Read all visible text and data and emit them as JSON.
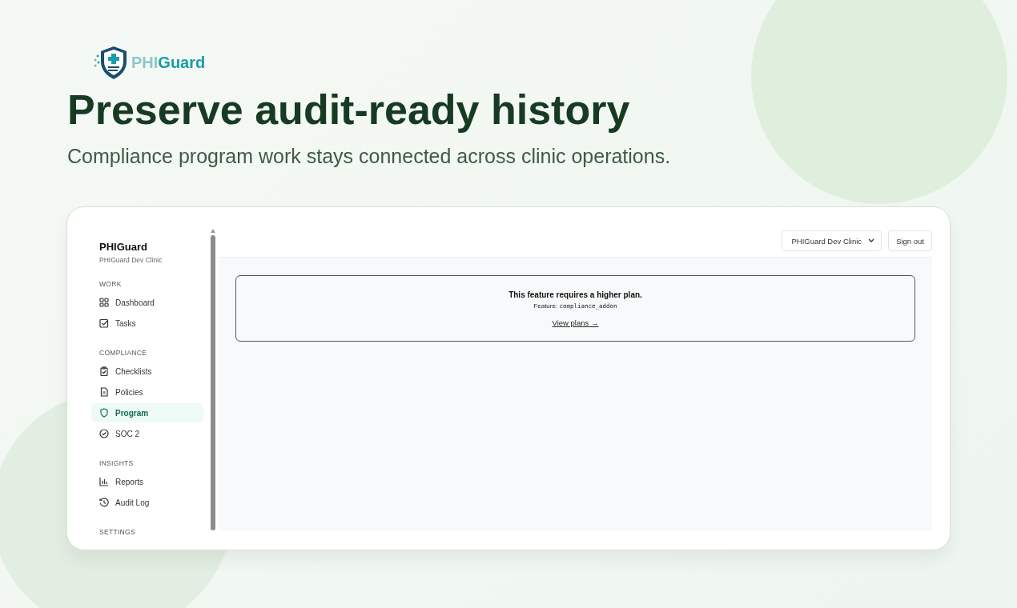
{
  "logo": {
    "part_1": "PHI",
    "part_2": "Guard"
  },
  "headline": "Preserve audit-ready history",
  "subheadline": "Compliance program work stays connected across clinic operations.",
  "app": {
    "sidebar": {
      "title": "PHIGuard",
      "subtitle": "PHIGuard Dev Clinic",
      "sections": [
        {
          "label": "WORK",
          "items": [
            {
              "label": "Dashboard",
              "kind": "grid",
              "selected": false
            },
            {
              "label": "Tasks",
              "kind": "check-square",
              "selected": false
            }
          ]
        },
        {
          "label": "COMPLIANCE",
          "items": [
            {
              "label": "Checklists",
              "kind": "clipboard",
              "selected": false
            },
            {
              "label": "Policies",
              "kind": "document",
              "selected": false
            },
            {
              "label": "Program",
              "kind": "shield",
              "selected": true
            },
            {
              "label": "SOC 2",
              "kind": "check-circle",
              "selected": false
            }
          ]
        },
        {
          "label": "INSIGHTS",
          "items": [
            {
              "label": "Reports",
              "kind": "bars",
              "selected": false
            },
            {
              "label": "Audit Log",
              "kind": "history",
              "selected": false
            }
          ]
        },
        {
          "label": "SETTINGS"
        }
      ]
    },
    "header": {
      "clinic_select": "PHIGuard Dev Clinic",
      "sign_out": "Sign out"
    },
    "notice": {
      "title": "This feature requires a higher plan.",
      "feature_label": "Feature:",
      "feature_code": "compliance_addon",
      "link": "View plans →"
    }
  }
}
